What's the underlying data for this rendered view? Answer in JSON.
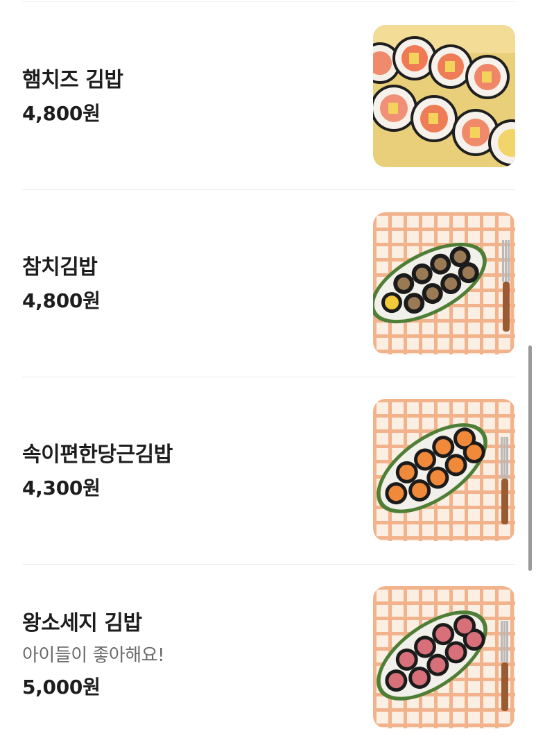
{
  "menu": {
    "items": [
      {
        "name": "햄치즈 김밥",
        "description": "",
        "price": "4,800원",
        "image_icon": "ham-cheese-gimbap-photo"
      },
      {
        "name": "참치김밥",
        "description": "",
        "price": "4,800원",
        "image_icon": "tuna-gimbap-photo"
      },
      {
        "name": "속이편한당근김밥",
        "description": "",
        "price": "4,300원",
        "image_icon": "carrot-gimbap-photo"
      },
      {
        "name": "왕소세지 김밥",
        "description": "아이들이 좋아해요!",
        "price": "5,000원",
        "image_icon": "sausage-gimbap-photo"
      }
    ]
  },
  "colors": {
    "text_primary": "#1d1d1d",
    "text_secondary": "#6a6a6a",
    "divider": "#ececec",
    "checker_orange": "#f2a77a"
  }
}
